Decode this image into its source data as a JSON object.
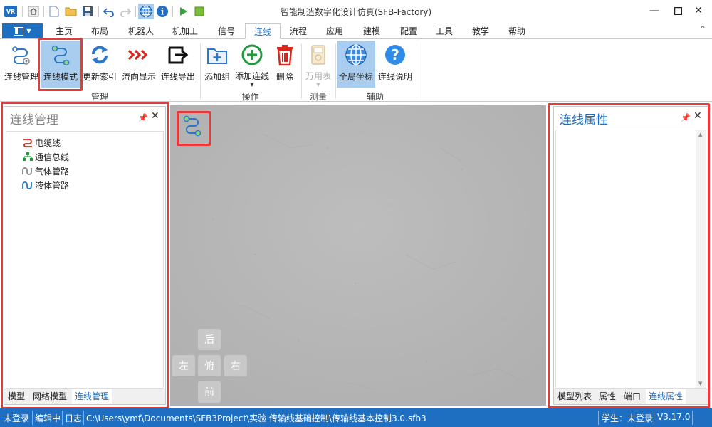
{
  "window": {
    "title": "智能制造数字化设计仿真(SFB-Factory)",
    "app_logo": "VR"
  },
  "quick_access": [
    "home-icon",
    "new-file-icon",
    "open-folder-icon",
    "save-icon",
    "undo-icon",
    "redo-icon",
    "globe-icon",
    "info-icon",
    "play-icon",
    "stop-icon"
  ],
  "menu": {
    "tabs": [
      "主页",
      "布局",
      "机器人",
      "机加工",
      "信号",
      "连线",
      "流程",
      "应用",
      "建模",
      "配置",
      "工具",
      "教学",
      "帮助"
    ],
    "active_tab": "连线"
  },
  "ribbon": {
    "groups": [
      {
        "label": "管理",
        "buttons": [
          {
            "label": "连线管理",
            "icon": "connection-manage-icon"
          },
          {
            "label": "连线模式",
            "icon": "connection-mode-icon",
            "selected": true
          },
          {
            "label": "更新索引",
            "icon": "refresh-icon"
          },
          {
            "label": "流向显示",
            "icon": "flow-direction-icon"
          },
          {
            "label": "连线导出",
            "icon": "export-icon"
          }
        ]
      },
      {
        "label": "操作",
        "buttons": [
          {
            "label": "添加组",
            "icon": "add-group-icon"
          },
          {
            "label": "添加连线",
            "icon": "add-connection-icon",
            "has_dropdown": true
          },
          {
            "label": "删除",
            "icon": "delete-icon"
          }
        ]
      },
      {
        "label": "测量",
        "buttons": [
          {
            "label": "万用表",
            "icon": "multimeter-icon",
            "disabled": true,
            "has_dropdown": true
          }
        ]
      },
      {
        "label": "辅助",
        "buttons": [
          {
            "label": "全局坐标",
            "icon": "globe-icon",
            "selected": true
          },
          {
            "label": "连线说明",
            "icon": "help-icon"
          }
        ]
      }
    ]
  },
  "left_panel": {
    "title": "连线管理",
    "tree": [
      {
        "label": "电缆线",
        "icon": "cable-icon"
      },
      {
        "label": "通信总线",
        "icon": "network-bus-icon"
      },
      {
        "label": "气体管路",
        "icon": "gas-pipe-icon"
      },
      {
        "label": "液体管路",
        "icon": "liquid-pipe-icon"
      }
    ],
    "tabs": [
      "模型",
      "网络模型",
      "连线管理"
    ],
    "active_tab": "连线管理"
  },
  "canvas": {
    "nav": {
      "back": "后",
      "left": "左",
      "top": "俯",
      "right": "右",
      "front": "前"
    }
  },
  "right_panel": {
    "title": "连线属性",
    "tabs": [
      "模型列表",
      "属性",
      "端口",
      "连线属性"
    ],
    "active_tab": "连线属性"
  },
  "status_bar": {
    "login": "未登录",
    "mode": "编辑中",
    "log": "日志",
    "path": "C:\\Users\\ymf\\Documents\\SFB3Project\\实验 传输线基础控制\\传输线基本控制3.0.sfb3",
    "student": "学生：未登录",
    "version": "V3.17.0"
  },
  "colors": {
    "accent": "#1e6fc2",
    "highlight": "#e8393d",
    "selected_bg": "#a9cdef",
    "canvas": "#b9b9b9"
  }
}
